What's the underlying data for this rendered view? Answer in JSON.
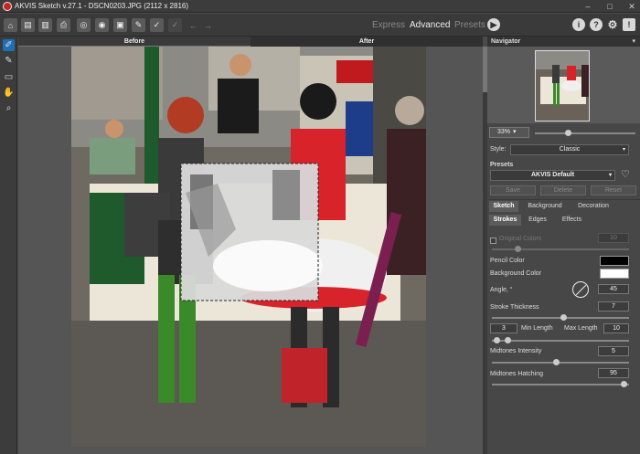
{
  "window": {
    "title": "AKVIS Sketch v.27.1 - DSCN0203.JPG (2112 x 2816)",
    "minimize": "–",
    "maximize": "□",
    "close": "✕"
  },
  "toolbar": {
    "modes": {
      "express": "Express",
      "advanced": "Advanced",
      "presets": "Presets"
    },
    "help": {
      "info": "i",
      "help": "?",
      "settings": "⚙",
      "notify": "!"
    }
  },
  "view_tabs": {
    "before": "Before",
    "after": "After"
  },
  "navigator": {
    "title": "Navigator",
    "zoom": "33%",
    "caret": "▾"
  },
  "settings": {
    "style_label": "Style:",
    "style_value": "Classic",
    "presets_label": "Presets",
    "preset_value": "AKVIS Default",
    "save": "Save",
    "delete": "Delete",
    "reset": "Reset",
    "main_tabs": [
      "Sketch",
      "Background",
      "Decoration"
    ],
    "sub_tabs": [
      "Strokes",
      "Edges",
      "Effects"
    ],
    "original_colors": "Original Colors",
    "original_colors_value": "10",
    "pencil_color": "Pencil Color",
    "background_color": "Background Color",
    "pencil_color_hex": "#000000",
    "background_color_hex": "#ffffff",
    "angle_label": "Angle, °",
    "angle_value": "45",
    "stroke_thickness_label": "Stroke Thickness",
    "stroke_thickness_value": "7",
    "min_length_value": "3",
    "min_length_label": "Min Length",
    "max_length_label": "Max Length",
    "max_length_value": "10",
    "midtones_intensity_label": "Midtones Intensity",
    "midtones_intensity_value": "5",
    "midtones_hatching_label": "Midtones Hatching",
    "midtones_hatching_value": "95"
  },
  "colors": {
    "accent": "#1e6fb8",
    "panel": "#474747",
    "dress_red": "#d8232a",
    "stocking_green": "#3a8a2a"
  }
}
